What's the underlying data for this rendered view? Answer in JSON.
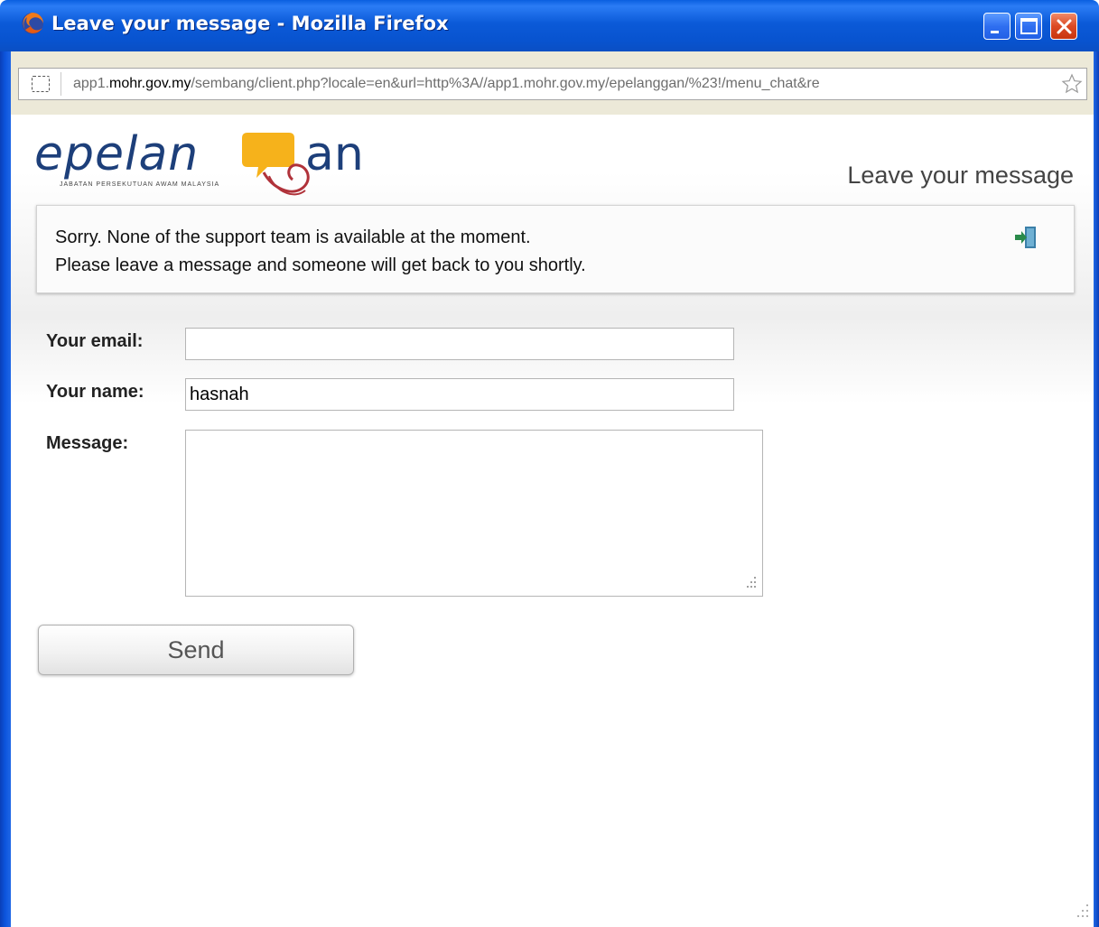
{
  "window": {
    "title": "Leave your message - Mozilla Firefox",
    "icon": "firefox-icon",
    "buttons": [
      "minimize-icon",
      "maximize-icon",
      "close-icon"
    ]
  },
  "urlbar": {
    "prefix": "app1.",
    "domain": "mohr.gov.my",
    "path": "/sembang/client.php?locale=en&url=http%3A//app1.mohr.gov.my/epelanggan/%23!/menu_chat&re",
    "site_icon": "site-identity-icon",
    "bookmark_icon": "star-icon"
  },
  "header": {
    "logo_part1": "epelan",
    "logo_part2": "an",
    "logo_subtitle": "JABATAN PERSEKUTUAN AWAM MALAYSIA",
    "title": "Leave your message"
  },
  "notice": {
    "line1": "Sorry. None of the support team is available at the moment.",
    "line2": "Please leave a message and someone will get back to you shortly.",
    "exit_icon": "exit-door-icon"
  },
  "form": {
    "email_label": "Your email:",
    "email_value": "",
    "name_label": "Your name:",
    "name_value": "hasnah",
    "message_label": "Message:",
    "message_value": "",
    "send_label": "Send"
  },
  "colors": {
    "titlebar": "#0b5ad8",
    "close_button": "#dc4a24",
    "logo_blue": "#1d3f7a",
    "logo_bubble": "#f6b21b",
    "logo_swirl": "#b0323a"
  }
}
